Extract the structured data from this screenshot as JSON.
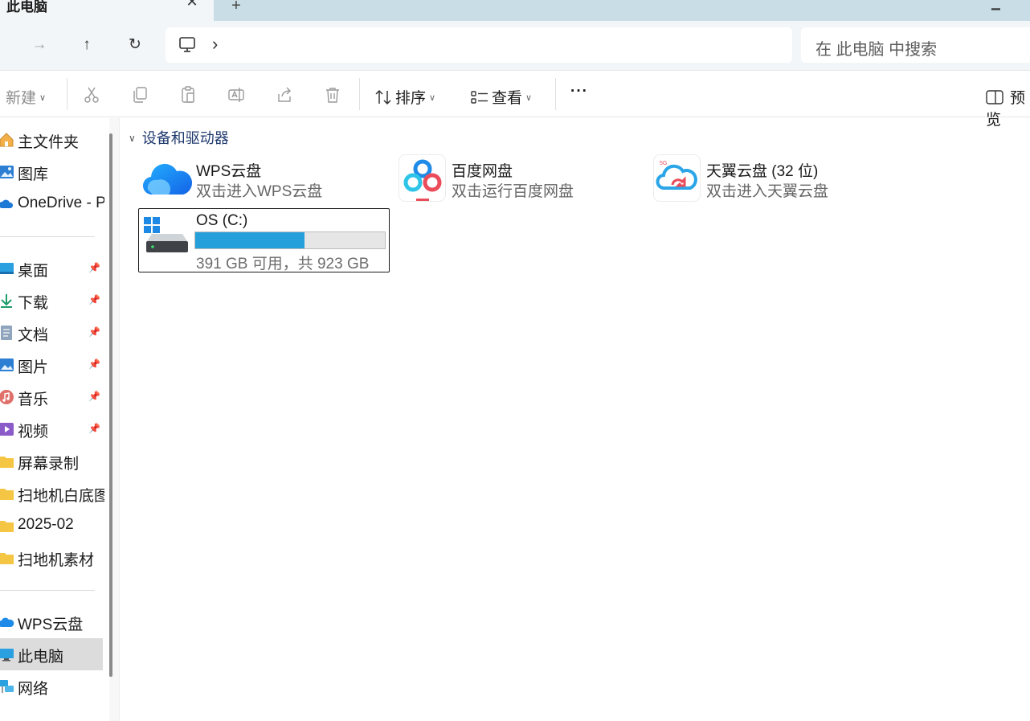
{
  "window": {
    "tab_title": "此电脑",
    "tab_close": "✕",
    "tab_new": "+",
    "window_control": "▁"
  },
  "nav": {
    "forward": "→",
    "up": "↑",
    "refresh": "↻",
    "breadcrumb_chevron": "›",
    "search_placeholder": "在 此电脑 中搜索"
  },
  "commands": {
    "new_label": "新建",
    "sort_label": "排序",
    "view_label": "查看",
    "more_label": "···",
    "preview_label": "预览"
  },
  "sidebar": {
    "items": [
      {
        "label": "主文件夹",
        "icon": "home-icon",
        "pinned": false
      },
      {
        "label": "图库",
        "icon": "gallery-icon",
        "pinned": false
      },
      {
        "label": "OneDrive - Personal",
        "icon": "onedrive-icon",
        "pinned": false
      },
      {
        "label": "桌面",
        "icon": "desktop-icon",
        "pinned": true
      },
      {
        "label": "下载",
        "icon": "download-icon",
        "pinned": true
      },
      {
        "label": "文档",
        "icon": "document-icon",
        "pinned": true
      },
      {
        "label": "图片",
        "icon": "pictures-icon",
        "pinned": true
      },
      {
        "label": "音乐",
        "icon": "music-icon",
        "pinned": true
      },
      {
        "label": "视频",
        "icon": "video-icon",
        "pinned": true
      },
      {
        "label": "屏幕录制",
        "icon": "folder-icon",
        "pinned": false
      },
      {
        "label": "扫地机白底图",
        "icon": "folder-icon",
        "pinned": false
      },
      {
        "label": "2025-02",
        "icon": "folder-icon",
        "pinned": false
      },
      {
        "label": "扫地机素材",
        "icon": "folder-icon",
        "pinned": false
      },
      {
        "label": "WPS云盘",
        "icon": "wps-cloud-icon",
        "pinned": false
      },
      {
        "label": "此电脑",
        "icon": "this-pc-icon",
        "pinned": false,
        "selected": true
      },
      {
        "label": "网络",
        "icon": "network-icon",
        "pinned": false
      }
    ],
    "pin_glyph": "📌"
  },
  "content": {
    "group_title": "设备和驱动器",
    "group_chevron": "∨",
    "tiles": [
      {
        "name": "WPS云盘",
        "sub": "双击进入WPS云盘",
        "icon": "wps-cloud-icon"
      },
      {
        "name": "百度网盘",
        "sub": "双击运行百度网盘",
        "icon": "baidu-netdisk-icon"
      },
      {
        "name": "天翼云盘 (32 位)",
        "sub": "双击进入天翼云盘",
        "icon": "tianyi-cloud-icon"
      }
    ],
    "drive": {
      "name": "OS (C:)",
      "sub": "391 GB 可用，共 923 GB",
      "used_fraction": 0.576
    }
  },
  "colors": {
    "accent": "#26a0da",
    "group_title": "#1f3a6e",
    "tab_bar": "#c8dde5"
  }
}
